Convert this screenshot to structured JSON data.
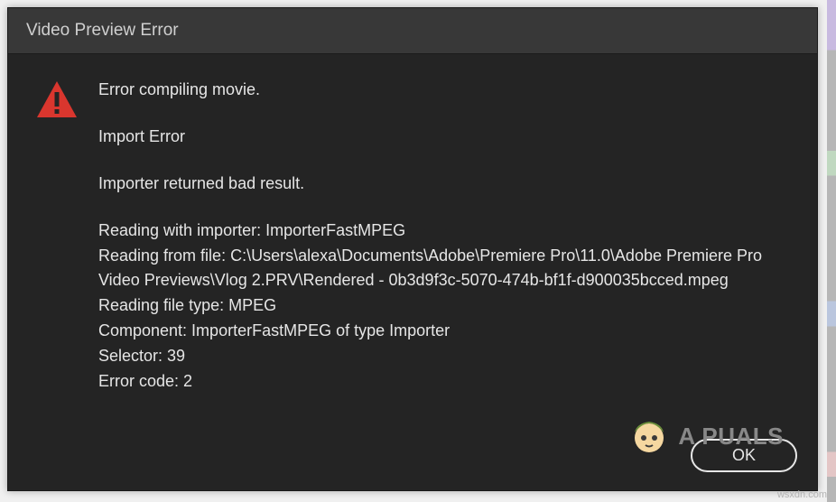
{
  "window": {
    "title": "Video Preview Error"
  },
  "message": {
    "line_error_compiling": "Error compiling movie.",
    "line_import_error": "Import Error",
    "line_bad_result": "Importer returned bad result.",
    "line_reading_importer": "Reading with importer: ImporterFastMPEG",
    "line_reading_file": "Reading from file: C:\\Users\\alexa\\Documents\\Adobe\\Premiere Pro\\11.0\\Adobe Premiere Pro Video Previews\\Vlog 2.PRV\\Rendered - 0b3d9f3c-5070-474b-bf1f-d900035bcced.mpeg",
    "line_file_type": "Reading file type: MPEG",
    "line_component": "Component: ImporterFastMPEG of type Importer",
    "line_selector": "Selector: 39",
    "line_error_code": "Error code: 2"
  },
  "buttons": {
    "ok": "OK"
  },
  "watermark": {
    "brand": "A  PUALS"
  },
  "footer": {
    "url": "wsxdn.com"
  }
}
